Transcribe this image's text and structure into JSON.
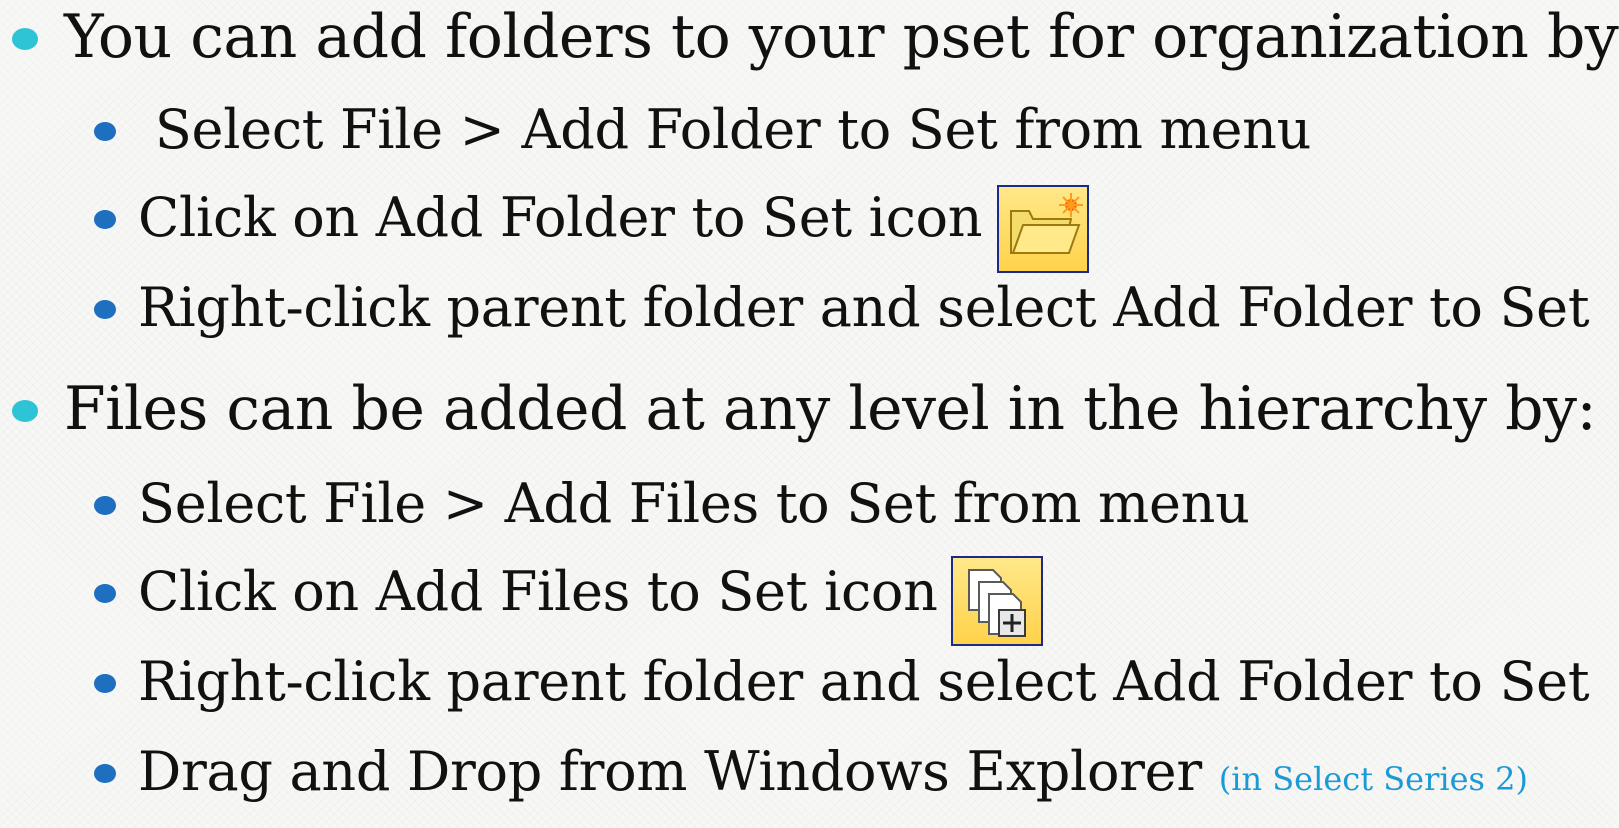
{
  "slide": {
    "colors": {
      "level1_bullet": "#2ec4d6",
      "level2_bullet": "#1f6fc0",
      "note_text": "#1b9ad6",
      "icon_border": "#1d2a8a",
      "icon_fill": "#ffd24a"
    },
    "sections": [
      {
        "heading": "You can add folders to your pset for organization by:",
        "items": [
          {
            "text": " Select File > Add Folder to Set from menu"
          },
          {
            "text": "Click on Add Folder to Set icon",
            "icon": "add-folder-to-set-icon"
          },
          {
            "text": "Right-click parent folder and select Add Folder to Set"
          }
        ]
      },
      {
        "heading": "Files can be added at any level in the hierarchy by:",
        "items": [
          {
            "text": "Select File > Add Files to Set from menu"
          },
          {
            "text": "Click on Add Files to Set icon",
            "icon": "add-files-to-set-icon"
          },
          {
            "text": "Right-click parent folder and select Add Folder to Set"
          },
          {
            "text": "Drag and Drop from Windows Explorer ",
            "note": "(in Select Series 2)"
          }
        ]
      }
    ]
  }
}
